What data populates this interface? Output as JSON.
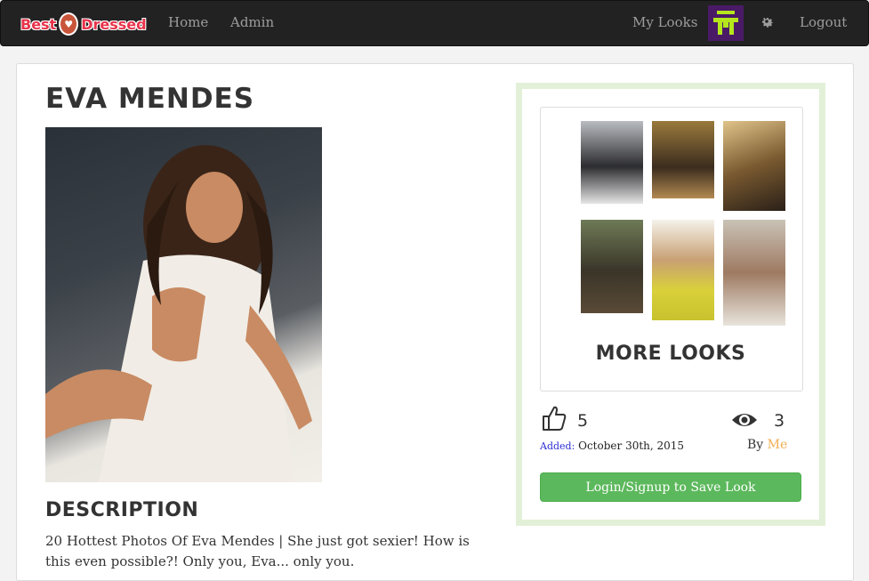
{
  "navbar": {
    "brand_left": "Best",
    "brand_right": "Dressed",
    "links": [
      "Home",
      "Admin"
    ],
    "my_looks": "My Looks",
    "logout": "Logout"
  },
  "look": {
    "title": "EVA MENDES",
    "description_heading": "DESCRIPTION",
    "description": "20 Hottest Photos Of Eva Mendes | She just got sexier! How is this even possible?! Only you, Eva... only you."
  },
  "sidebar": {
    "more_looks": "MORE LOOKS",
    "likes": "5",
    "views": "3",
    "added_label": "Added:",
    "added_date": "October 30th, 2015",
    "by_label": "By",
    "by_user": "Me",
    "save_button": "Login/Signup to Save Look"
  },
  "colors": {
    "navbar_bg": "#222222",
    "brand": "#e8334a",
    "button_green": "#5cb85c",
    "user_link": "#f0ad4e",
    "sidebar_border": "#e3f0d8"
  }
}
